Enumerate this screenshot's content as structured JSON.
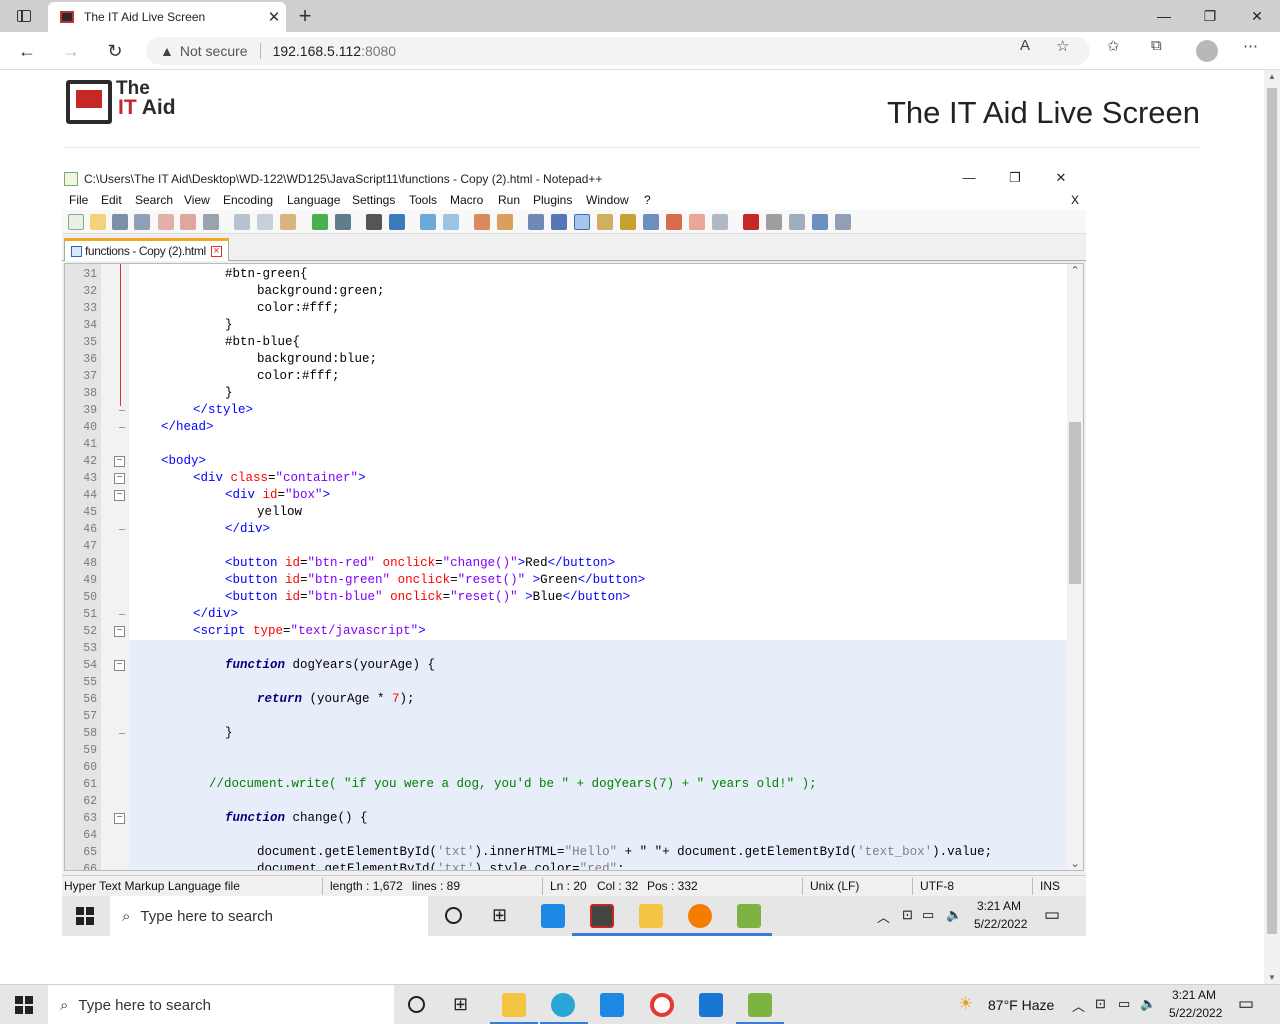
{
  "browser": {
    "tab_title": "The IT Aid Live Screen",
    "tab_close": "✕",
    "new_tab": "+",
    "controls": {
      "minimize": "—",
      "maximize": "❐",
      "close": "✕"
    },
    "security_label": "Not secure",
    "url_host": "192.168.5.112",
    "url_port": ":8080",
    "menu": "⋯"
  },
  "page": {
    "logo_the": "The",
    "logo_it": "IT",
    "logo_aid": " Aid",
    "heading": "The IT Aid Live Screen"
  },
  "npp": {
    "title": "C:\\Users\\The IT Aid\\Desktop\\WD-122\\WD125\\JavaScript11\\functions - Copy (2).html - Notepad++",
    "menu": [
      "File",
      "Edit",
      "Search",
      "View",
      "Encoding",
      "Language",
      "Settings",
      "Tools",
      "Macro",
      "Run",
      "Plugins",
      "Window",
      "?"
    ],
    "menu_close": "X",
    "tab_label": "functions - Copy (2).html",
    "status": {
      "filetype": "Hyper Text Markup Language file",
      "length": "length : 1,672",
      "lines": "lines : 89",
      "ln": "Ln : 20",
      "col": "Col : 32",
      "pos": "Pos : 332",
      "eol": "Unix (LF)",
      "encoding": "UTF-8",
      "mode": "INS"
    }
  },
  "code_lines": [
    {
      "n": "31",
      "hl": false,
      "tokens": [
        [
          "#btn-green{",
          "text"
        ]
      ]
    },
    {
      "n": "32",
      "hl": false,
      "tokens": [
        [
          "background:green;",
          "text"
        ]
      ]
    },
    {
      "n": "33",
      "hl": false,
      "tokens": [
        [
          "color:#fff;",
          "text"
        ]
      ]
    },
    {
      "n": "34",
      "hl": false,
      "tokens": [
        [
          "}",
          "text"
        ]
      ]
    },
    {
      "n": "35",
      "hl": false,
      "tokens": [
        [
          "#btn-blue{",
          "text"
        ]
      ]
    },
    {
      "n": "36",
      "hl": false,
      "tokens": [
        [
          "background:blue;",
          "text"
        ]
      ]
    },
    {
      "n": "37",
      "hl": false,
      "tokens": [
        [
          "color:#fff;",
          "text"
        ]
      ]
    },
    {
      "n": "38",
      "hl": false,
      "tokens": [
        [
          "}",
          "text"
        ]
      ]
    },
    {
      "n": "39",
      "hl": false,
      "tokens": [
        [
          "</style>",
          "tag"
        ]
      ]
    },
    {
      "n": "40",
      "hl": false,
      "tokens": [
        [
          "</head>",
          "tag"
        ]
      ]
    },
    {
      "n": "41",
      "hl": false,
      "tokens": []
    },
    {
      "n": "42",
      "hl": false,
      "tokens": [
        [
          "<body>",
          "tag"
        ]
      ]
    },
    {
      "n": "43",
      "hl": false,
      "tokens": [
        [
          "<div ",
          "tag"
        ],
        [
          "class",
          "attr"
        ],
        [
          "=",
          "text"
        ],
        [
          "\"container\"",
          "str"
        ],
        [
          ">",
          "tag"
        ]
      ]
    },
    {
      "n": "44",
      "hl": false,
      "tokens": [
        [
          "<div ",
          "tag"
        ],
        [
          "id",
          "attr"
        ],
        [
          "=",
          "text"
        ],
        [
          "\"box\"",
          "str"
        ],
        [
          ">",
          "tag"
        ]
      ]
    },
    {
      "n": "45",
      "hl": false,
      "tokens": [
        [
          "yellow",
          "text"
        ]
      ]
    },
    {
      "n": "46",
      "hl": false,
      "tokens": [
        [
          "</div>",
          "tag"
        ]
      ]
    },
    {
      "n": "47",
      "hl": false,
      "tokens": []
    },
    {
      "n": "48",
      "hl": false,
      "tokens": [
        [
          "<button ",
          "tag"
        ],
        [
          "id",
          "attr"
        ],
        [
          "=",
          "text"
        ],
        [
          "\"btn-red\"",
          "str"
        ],
        [
          " onclick",
          "attr"
        ],
        [
          "=",
          "text"
        ],
        [
          "\"change()\"",
          "str"
        ],
        [
          ">",
          "tag"
        ],
        [
          "Red",
          "text"
        ],
        [
          "</button>",
          "tag"
        ]
      ]
    },
    {
      "n": "49",
      "hl": false,
      "tokens": [
        [
          "<button ",
          "tag"
        ],
        [
          "id",
          "attr"
        ],
        [
          "=",
          "text"
        ],
        [
          "\"btn-green\"",
          "str"
        ],
        [
          " onclick",
          "attr"
        ],
        [
          "=",
          "text"
        ],
        [
          "\"reset()\"",
          "str"
        ],
        [
          " >",
          "tag"
        ],
        [
          "Green",
          "text"
        ],
        [
          "</button>",
          "tag"
        ]
      ]
    },
    {
      "n": "50",
      "hl": false,
      "tokens": [
        [
          "<button ",
          "tag"
        ],
        [
          "id",
          "attr"
        ],
        [
          "=",
          "text"
        ],
        [
          "\"btn-blue\"",
          "str"
        ],
        [
          " onclick",
          "attr"
        ],
        [
          "=",
          "text"
        ],
        [
          "\"reset()\"",
          "str"
        ],
        [
          " >",
          "tag"
        ],
        [
          "Blue",
          "text"
        ],
        [
          "</button>",
          "tag"
        ]
      ]
    },
    {
      "n": "51",
      "hl": false,
      "tokens": [
        [
          "</div>",
          "tag"
        ]
      ]
    },
    {
      "n": "52",
      "hl": false,
      "tokens": [
        [
          "<script ",
          "tag"
        ],
        [
          "type",
          "attr"
        ],
        [
          "=",
          "text"
        ],
        [
          "\"text/javascript\"",
          "str"
        ],
        [
          ">",
          "tag"
        ]
      ]
    },
    {
      "n": "53",
      "hl": true,
      "tokens": []
    },
    {
      "n": "54",
      "hl": true,
      "tokens": [
        [
          "function",
          "kw"
        ],
        [
          " dogYears(yourAge) {",
          "text"
        ]
      ]
    },
    {
      "n": "55",
      "hl": true,
      "tokens": []
    },
    {
      "n": "56",
      "hl": true,
      "tokens": [
        [
          "return",
          "kw"
        ],
        [
          " (yourAge * ",
          "text"
        ],
        [
          "7",
          "num"
        ],
        [
          ");",
          "text"
        ]
      ]
    },
    {
      "n": "57",
      "hl": true,
      "tokens": []
    },
    {
      "n": "58",
      "hl": true,
      "tokens": [
        [
          "}",
          "text"
        ]
      ]
    },
    {
      "n": "59",
      "hl": true,
      "tokens": []
    },
    {
      "n": "60",
      "hl": true,
      "tokens": []
    },
    {
      "n": "61",
      "hl": true,
      "tokens": [
        [
          "//document.write( \"if you were a dog, you'd be \" + dogYears(7) + \" years old!\" );",
          "com"
        ]
      ]
    },
    {
      "n": "62",
      "hl": true,
      "tokens": []
    },
    {
      "n": "63",
      "hl": true,
      "tokens": [
        [
          "function",
          "kw"
        ],
        [
          " change() {",
          "text"
        ]
      ]
    },
    {
      "n": "64",
      "hl": true,
      "tokens": []
    },
    {
      "n": "65",
      "hl": true,
      "tokens": [
        [
          "document.getElementById(",
          "text"
        ],
        [
          "'txt'",
          "sq"
        ],
        [
          ").innerHTML=",
          "text"
        ],
        [
          "\"Hello\"",
          "sq"
        ],
        [
          " + \" \"+ document.getElementById(",
          "text"
        ],
        [
          "'text_box'",
          "sq"
        ],
        [
          ").value;",
          "text"
        ]
      ]
    },
    {
      "n": "66",
      "hl": true,
      "tokens": [
        [
          "document.getElementById(",
          "text"
        ],
        [
          "'txt'",
          "sq"
        ],
        [
          ").style.color=",
          "text"
        ],
        [
          "\"red\"",
          "sq"
        ],
        [
          ";",
          "text"
        ]
      ]
    }
  ],
  "remote_taskbar": {
    "search_placeholder": "Type here to search",
    "time": "3:21 AM",
    "date": "5/22/2022"
  },
  "taskbar": {
    "search_placeholder": "Type here to search",
    "weather": "87°F  Haze",
    "time": "3:21 AM",
    "date": "5/22/2022"
  },
  "colors": {
    "tag": "#0000ff",
    "attr": "#ff0000",
    "string": "#8000ff",
    "keyword": "#000080",
    "comment": "#008000",
    "highlight": "#e8eef9"
  }
}
